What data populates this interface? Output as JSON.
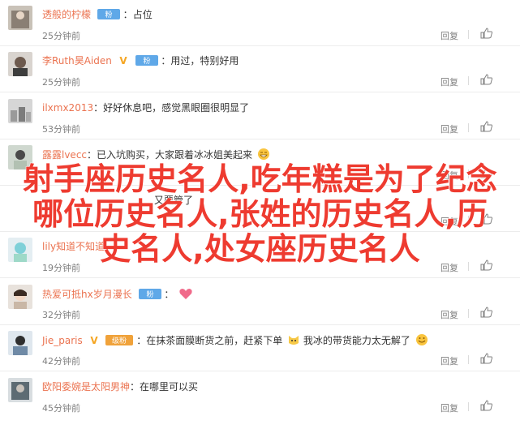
{
  "comments": [
    {
      "user": "透般的柠檬",
      "badge": "vip",
      "text": "占位",
      "time": "25分钟前",
      "reply": "回复"
    },
    {
      "user": "李Ruth昊Aiden",
      "badge": "vip-yellow",
      "text": "用过，特别好用",
      "time": "25分钟前",
      "reply": "回复"
    },
    {
      "user": "ilxmx2013",
      "badge": "",
      "text": "好好休息吧，感觉黑眼圈很明显了",
      "time": "53分钟前",
      "reply": "回复"
    },
    {
      "user": "露露lvecc",
      "badge": "",
      "text": "已入坑购买，大家跟着冰冰姐美起来",
      "time": "",
      "reply": "回复"
    },
    {
      "user": "",
      "badge": "",
      "text": "又要管了",
      "time": "",
      "reply": "回复"
    },
    {
      "user": "lily知道不知道",
      "badge": "",
      "text": "",
      "time": "19分钟前",
      "reply": "回复"
    },
    {
      "user": "热爱可抵hx岁月漫长",
      "badge": "vip",
      "text": "",
      "time": "32分钟前",
      "reply": "回复"
    },
    {
      "user": "Jie_paris",
      "badge": "vip-multi",
      "text": "在抹茶面膜断货之前，赶紧下单",
      "text2": "我冰的带货能力太无解了",
      "time": "42分钟前",
      "reply": "回复"
    },
    {
      "user": "欧阳委婉是太阳男神",
      "badge": "",
      "text": "在哪里可以买",
      "time": "45分钟前",
      "reply": "回复"
    }
  ],
  "overlay": {
    "line1": "射手座历史名人,吃年糕是为了纪念",
    "line2": "哪位历史名人,张姓的历史名人,历",
    "line3": "史名人,处女座历史名人"
  },
  "colors": {
    "username": "#eb7350",
    "overlay": "#ee3b30",
    "badge": "#5fa8e8",
    "meta": "#808080"
  }
}
